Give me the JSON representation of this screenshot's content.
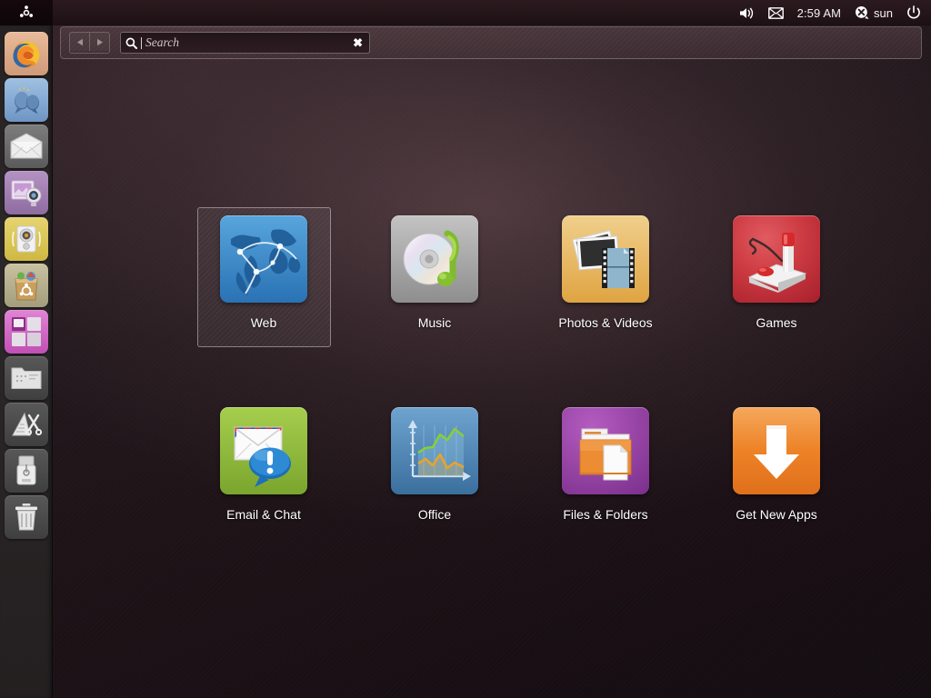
{
  "panel": {
    "bfb_icon": "ubuntu-logo-icon",
    "indicators": [
      {
        "name": "volume-indicator",
        "icon": "speaker-icon",
        "label": ""
      },
      {
        "name": "messaging-indicator",
        "icon": "envelope-icon",
        "label": ""
      }
    ],
    "clock": "2:59 AM",
    "session": {
      "user_icon": "user-avatar-icon",
      "user": "sun",
      "power_icon": "power-icon"
    }
  },
  "launcher": {
    "items": [
      {
        "name": "launcher-item-firefox",
        "label": "Firefox Web Browser",
        "icon": "firefox-icon"
      },
      {
        "name": "launcher-item-empathy",
        "label": "Empathy",
        "icon": "chat-balloons-icon"
      },
      {
        "name": "launcher-item-thunderbird",
        "label": "Thunderbird Mail",
        "icon": "mail-envelope-icon"
      },
      {
        "name": "launcher-item-shotwell",
        "label": "Shotwell Photo",
        "icon": "photo-webcam-icon"
      },
      {
        "name": "launcher-item-rhythmbox",
        "label": "Rhythmbox",
        "icon": "music-speaker-icon"
      },
      {
        "name": "launcher-item-software-center",
        "label": "Ubuntu Software Center",
        "icon": "shopping-bag-icon"
      },
      {
        "name": "launcher-item-workspaces",
        "label": "Workspace Switcher",
        "icon": "workspace-switcher-icon"
      },
      {
        "name": "launcher-item-files",
        "label": "Files",
        "icon": "folder-icon"
      },
      {
        "name": "launcher-item-design",
        "label": "Design Tools",
        "icon": "ruler-scissors-icon"
      },
      {
        "name": "launcher-item-usb-device",
        "label": "USB Device",
        "icon": "usb-drive-icon"
      },
      {
        "name": "launcher-item-trash",
        "label": "Trash",
        "icon": "trash-icon"
      }
    ]
  },
  "dash": {
    "nav": {
      "back_label": "◀",
      "forward_label": "▶"
    },
    "search": {
      "icon": "magnifier-icon",
      "placeholder": "Search",
      "value": "",
      "clear_label": "✖"
    },
    "tiles": [
      {
        "name": "tile-web",
        "label": "Web",
        "icon": "globe-network-icon",
        "selected": true
      },
      {
        "name": "tile-music",
        "label": "Music",
        "icon": "cd-music-note-icon",
        "selected": false
      },
      {
        "name": "tile-photos-videos",
        "label": "Photos & Videos",
        "icon": "photos-film-icon",
        "selected": false
      },
      {
        "name": "tile-games",
        "label": "Games",
        "icon": "joystick-icon",
        "selected": false
      },
      {
        "name": "tile-email-chat",
        "label": "Email & Chat",
        "icon": "envelope-bubble-icon",
        "selected": false
      },
      {
        "name": "tile-office",
        "label": "Office",
        "icon": "line-chart-icon",
        "selected": false
      },
      {
        "name": "tile-files-folders",
        "label": "Files & Folders",
        "icon": "folder-document-icon",
        "selected": false
      },
      {
        "name": "tile-get-new-apps",
        "label": "Get New Apps",
        "icon": "download-arrow-icon",
        "selected": false
      }
    ]
  },
  "colors": {
    "panel_bg": "#241519",
    "dash_bg": "#1e1418",
    "launcher_bg": "#2c2829",
    "accent_orange": "#e8823a",
    "tile_web": "#2f7fc4",
    "tile_music": "#9a9a9a",
    "tile_photos": "#e8b257",
    "tile_games": "#cc3a41",
    "tile_email": "#93c03a",
    "tile_office": "#4b87bd",
    "tile_files": "#9a47a8",
    "tile_apps": "#ee8228",
    "text": "#ffffff"
  }
}
